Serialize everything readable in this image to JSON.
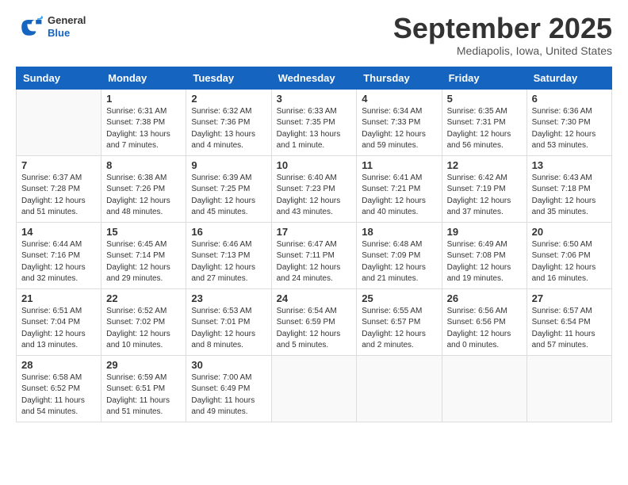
{
  "logo": {
    "general": "General",
    "blue": "Blue"
  },
  "title": "September 2025",
  "location": "Mediapolis, Iowa, United States",
  "days_of_week": [
    "Sunday",
    "Monday",
    "Tuesday",
    "Wednesday",
    "Thursday",
    "Friday",
    "Saturday"
  ],
  "weeks": [
    [
      {
        "day": "",
        "info": ""
      },
      {
        "day": "1",
        "info": "Sunrise: 6:31 AM\nSunset: 7:38 PM\nDaylight: 13 hours\nand 7 minutes."
      },
      {
        "day": "2",
        "info": "Sunrise: 6:32 AM\nSunset: 7:36 PM\nDaylight: 13 hours\nand 4 minutes."
      },
      {
        "day": "3",
        "info": "Sunrise: 6:33 AM\nSunset: 7:35 PM\nDaylight: 13 hours\nand 1 minute."
      },
      {
        "day": "4",
        "info": "Sunrise: 6:34 AM\nSunset: 7:33 PM\nDaylight: 12 hours\nand 59 minutes."
      },
      {
        "day": "5",
        "info": "Sunrise: 6:35 AM\nSunset: 7:31 PM\nDaylight: 12 hours\nand 56 minutes."
      },
      {
        "day": "6",
        "info": "Sunrise: 6:36 AM\nSunset: 7:30 PM\nDaylight: 12 hours\nand 53 minutes."
      }
    ],
    [
      {
        "day": "7",
        "info": "Sunrise: 6:37 AM\nSunset: 7:28 PM\nDaylight: 12 hours\nand 51 minutes."
      },
      {
        "day": "8",
        "info": "Sunrise: 6:38 AM\nSunset: 7:26 PM\nDaylight: 12 hours\nand 48 minutes."
      },
      {
        "day": "9",
        "info": "Sunrise: 6:39 AM\nSunset: 7:25 PM\nDaylight: 12 hours\nand 45 minutes."
      },
      {
        "day": "10",
        "info": "Sunrise: 6:40 AM\nSunset: 7:23 PM\nDaylight: 12 hours\nand 43 minutes."
      },
      {
        "day": "11",
        "info": "Sunrise: 6:41 AM\nSunset: 7:21 PM\nDaylight: 12 hours\nand 40 minutes."
      },
      {
        "day": "12",
        "info": "Sunrise: 6:42 AM\nSunset: 7:19 PM\nDaylight: 12 hours\nand 37 minutes."
      },
      {
        "day": "13",
        "info": "Sunrise: 6:43 AM\nSunset: 7:18 PM\nDaylight: 12 hours\nand 35 minutes."
      }
    ],
    [
      {
        "day": "14",
        "info": "Sunrise: 6:44 AM\nSunset: 7:16 PM\nDaylight: 12 hours\nand 32 minutes."
      },
      {
        "day": "15",
        "info": "Sunrise: 6:45 AM\nSunset: 7:14 PM\nDaylight: 12 hours\nand 29 minutes."
      },
      {
        "day": "16",
        "info": "Sunrise: 6:46 AM\nSunset: 7:13 PM\nDaylight: 12 hours\nand 27 minutes."
      },
      {
        "day": "17",
        "info": "Sunrise: 6:47 AM\nSunset: 7:11 PM\nDaylight: 12 hours\nand 24 minutes."
      },
      {
        "day": "18",
        "info": "Sunrise: 6:48 AM\nSunset: 7:09 PM\nDaylight: 12 hours\nand 21 minutes."
      },
      {
        "day": "19",
        "info": "Sunrise: 6:49 AM\nSunset: 7:08 PM\nDaylight: 12 hours\nand 19 minutes."
      },
      {
        "day": "20",
        "info": "Sunrise: 6:50 AM\nSunset: 7:06 PM\nDaylight: 12 hours\nand 16 minutes."
      }
    ],
    [
      {
        "day": "21",
        "info": "Sunrise: 6:51 AM\nSunset: 7:04 PM\nDaylight: 12 hours\nand 13 minutes."
      },
      {
        "day": "22",
        "info": "Sunrise: 6:52 AM\nSunset: 7:02 PM\nDaylight: 12 hours\nand 10 minutes."
      },
      {
        "day": "23",
        "info": "Sunrise: 6:53 AM\nSunset: 7:01 PM\nDaylight: 12 hours\nand 8 minutes."
      },
      {
        "day": "24",
        "info": "Sunrise: 6:54 AM\nSunset: 6:59 PM\nDaylight: 12 hours\nand 5 minutes."
      },
      {
        "day": "25",
        "info": "Sunrise: 6:55 AM\nSunset: 6:57 PM\nDaylight: 12 hours\nand 2 minutes."
      },
      {
        "day": "26",
        "info": "Sunrise: 6:56 AM\nSunset: 6:56 PM\nDaylight: 12 hours\nand 0 minutes."
      },
      {
        "day": "27",
        "info": "Sunrise: 6:57 AM\nSunset: 6:54 PM\nDaylight: 11 hours\nand 57 minutes."
      }
    ],
    [
      {
        "day": "28",
        "info": "Sunrise: 6:58 AM\nSunset: 6:52 PM\nDaylight: 11 hours\nand 54 minutes."
      },
      {
        "day": "29",
        "info": "Sunrise: 6:59 AM\nSunset: 6:51 PM\nDaylight: 11 hours\nand 51 minutes."
      },
      {
        "day": "30",
        "info": "Sunrise: 7:00 AM\nSunset: 6:49 PM\nDaylight: 11 hours\nand 49 minutes."
      },
      {
        "day": "",
        "info": ""
      },
      {
        "day": "",
        "info": ""
      },
      {
        "day": "",
        "info": ""
      },
      {
        "day": "",
        "info": ""
      }
    ]
  ]
}
